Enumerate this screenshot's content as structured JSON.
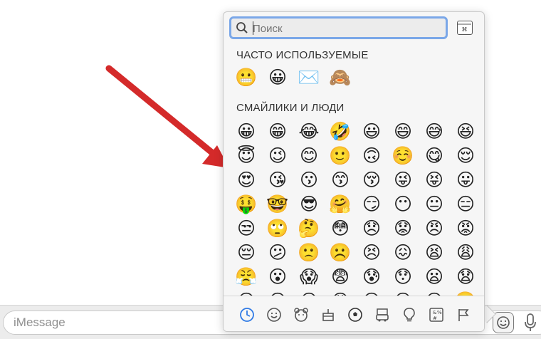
{
  "message_bar": {
    "placeholder": "iMessage"
  },
  "picker": {
    "search_placeholder": "Поиск",
    "frequent_title": "ЧАСТО ИСПОЛЬЗУЕМЫЕ",
    "frequent": [
      "😬",
      "😀",
      "✉️",
      "🙈"
    ],
    "smileys_title": "СМАЙЛИКИ И ЛЮДИ",
    "smileys": [
      [
        "😀",
        "😁",
        "😂",
        "🤣",
        "😃",
        "😄",
        "😅",
        "😆"
      ],
      [
        "😇",
        "😉",
        "😊",
        "🙂",
        "🙃",
        "☺️",
        "😋",
        "😌"
      ],
      [
        "😍",
        "😘",
        "😗",
        "😙",
        "😚",
        "😜",
        "😝",
        "😛"
      ],
      [
        "🤑",
        "🤓",
        "😎",
        "🤗",
        "😏",
        "😶",
        "😐",
        "😑"
      ],
      [
        "😒",
        "🙄",
        "🤔",
        "😳",
        "😞",
        "😟",
        "😠",
        "😡"
      ],
      [
        "😔",
        "😕",
        "🙁",
        "☹️",
        "😣",
        "😖",
        "😫",
        "😩"
      ],
      [
        "😤",
        "😮",
        "😱",
        "😨",
        "😰",
        "😯",
        "😦",
        "😧"
      ],
      [
        "😢",
        "😥",
        "😪",
        "😓",
        "😭",
        "😵",
        "😲",
        "🤐"
      ]
    ],
    "categories": [
      "recent-clock-icon",
      "smiley-icon",
      "animal-icon",
      "food-icon",
      "sports-ball-icon",
      "travel-icon",
      "lightbulb-icon",
      "symbols-icon",
      "flag-icon"
    ]
  },
  "colors": {
    "arrow": "#d42a2a",
    "search_focus": "#7aa7e8",
    "active_category": "#2f7ae5"
  }
}
